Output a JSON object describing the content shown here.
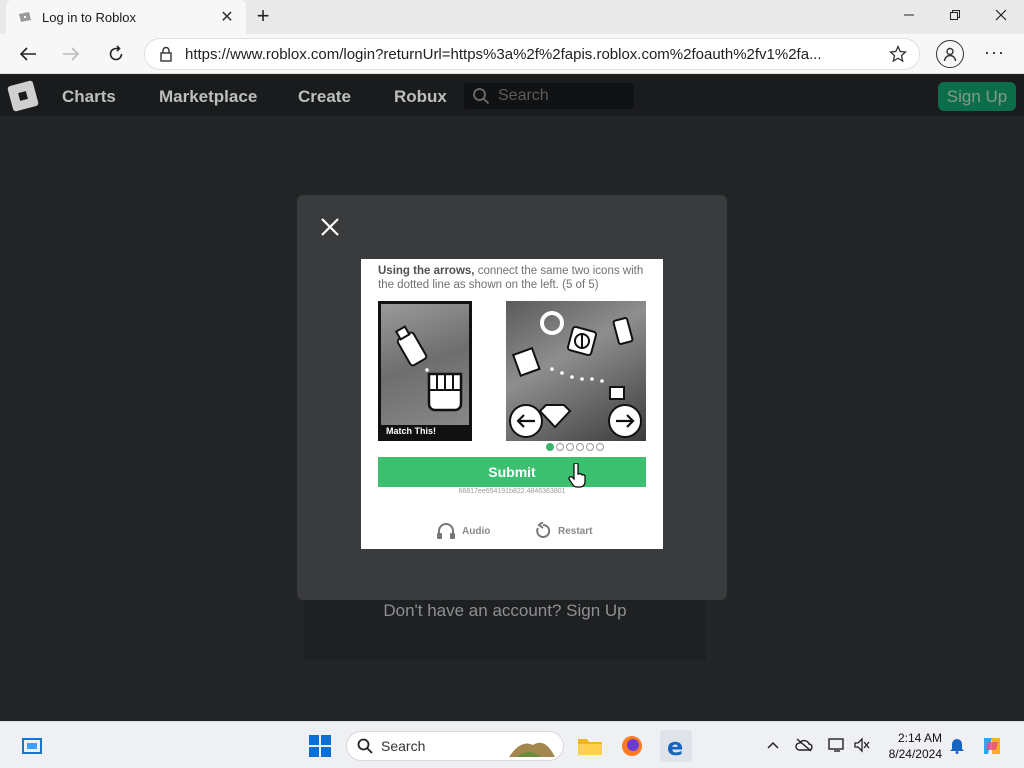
{
  "browser": {
    "tab_title": "Log in to Roblox",
    "url": "https://www.roblox.com/login?returnUrl=https%3a%2f%2fapis.roblox.com%2foauth%2fv1%2fa..."
  },
  "roblox_header": {
    "nav": [
      "Charts",
      "Marketplace",
      "Create",
      "Robux"
    ],
    "search_placeholder": "Search",
    "signup_label": "Sign Up"
  },
  "page": {
    "signup_prompt": "Don't have an account? Sign Up"
  },
  "captcha": {
    "instruction_bold": "Using the arrows,",
    "instruction_rest": " connect the same two icons with the dotted line as shown on the left. (5 of 5)",
    "match_label": "Match This!",
    "submit_label": "Submit",
    "session_id": "66817ee654191b822.4846363801",
    "audio_label": "Audio",
    "restart_label": "Restart",
    "progress_dots": 6,
    "progress_active": 1
  },
  "taskbar": {
    "search_label": "Search",
    "time": "2:14 AM",
    "date": "8/24/2024"
  },
  "colors": {
    "roblox_header": "#191b1d",
    "page_background": "#232527",
    "submit_green": "#3cbf6e",
    "signup_green": "#00b06f"
  }
}
